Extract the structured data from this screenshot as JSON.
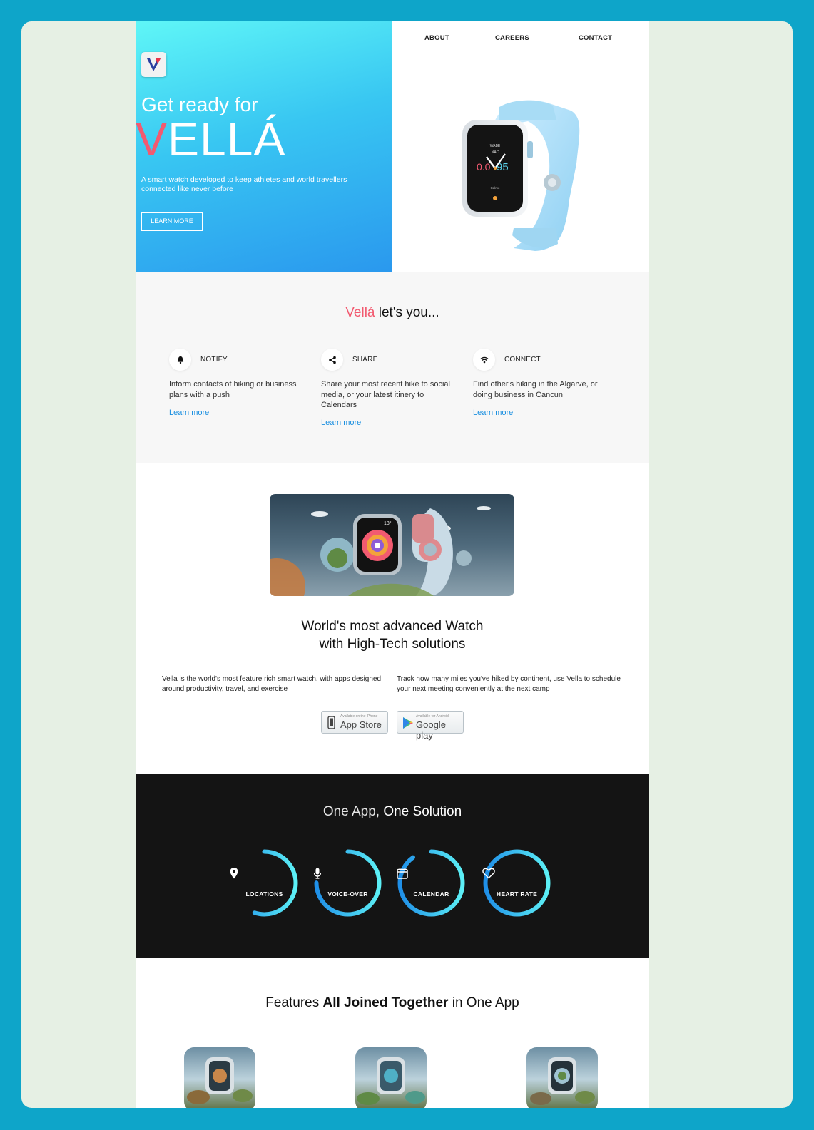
{
  "nav": {
    "about": "ABOUT",
    "careers": "CAREERS",
    "contact": "CONTACT"
  },
  "hero": {
    "kicker": "Get ready for",
    "title_first": "V",
    "title_rest": "ELLÁ",
    "description": "A smart watch developed to keep athletes and world travellers connected like never before",
    "button": "LEARN MORE",
    "watch_face": {
      "top1": "WABE",
      "top2": "NAC",
      "left": "0.0",
      "right": "95",
      "bottom": "Calme"
    }
  },
  "lets": {
    "brand": "Vellá",
    "title_rest": " let's you...",
    "features": [
      {
        "icon": "bell-icon",
        "name": "NOTIFY",
        "desc": "Inform contacts of hiking or business plans with a push",
        "link": "Learn more"
      },
      {
        "icon": "share-icon",
        "name": "SHARE",
        "desc": "Share your most recent hike to social media, or your latest itinery to Calendars",
        "link": "Learn more"
      },
      {
        "icon": "wifi-icon",
        "name": "CONNECT",
        "desc": "Find other's hiking in the Algarve, or doing business in Cancun",
        "link": "Learn more"
      }
    ]
  },
  "advanced": {
    "title_a": "World's ",
    "title_b": "most advanced Watch",
    "title_c": "with High-Tech solutions",
    "col1": "Vella is the world's most feature rich smart watch, with apps designed around productivity, travel, and exercise",
    "col2": "Track how many miles you've hiked by continent, use Vella to schedule your next meeting conveniently at the next camp",
    "appstore_small": "Available on the iPhone",
    "appstore_big": "App Store",
    "googleplay_small": "Available for Android",
    "googleplay_big": "Google play",
    "scene_badge": "18°"
  },
  "oneapp": {
    "title_a": "One App, ",
    "title_b": "One Solution",
    "items": [
      {
        "label": "LOCATIONS",
        "icon": "location-pin-icon",
        "progress": 0.55
      },
      {
        "label": "VOICE-OVER",
        "icon": "microphone-icon",
        "progress": 0.75
      },
      {
        "label": "CALENDAR",
        "icon": "calendar-icon",
        "progress": 0.9
      },
      {
        "label": "HEART RATE",
        "icon": "heart-icon",
        "progress": 1.0
      }
    ]
  },
  "joined": {
    "title_a": "Features ",
    "title_b": "All Joined Together",
    "title_c": " in One App"
  },
  "colors": {
    "accent_pink": "#f25a70",
    "link_blue": "#1a8fe0",
    "ring_start": "#1f8fe8",
    "ring_end": "#5cf0f6"
  }
}
